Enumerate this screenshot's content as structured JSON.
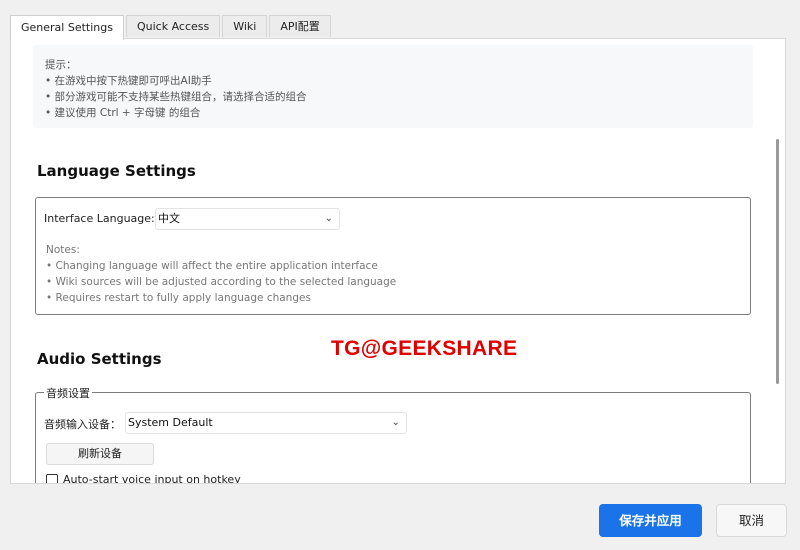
{
  "tabs": [
    {
      "label": "General Settings"
    },
    {
      "label": "Quick Access"
    },
    {
      "label": "Wiki"
    },
    {
      "label": "API配置"
    }
  ],
  "hotkey_hints": {
    "heading": "提示：",
    "lines": [
      "• 在游戏中按下热键即可呼出AI助手",
      "• 部分游戏可能不支持某些热键组合，请选择合适的组合",
      "• 建议使用 Ctrl + 字母键 的组合"
    ]
  },
  "language_settings": {
    "title": "Language Settings",
    "interface_language_label": "Interface Language:",
    "interface_language_value": "中文",
    "notes_heading": "Notes:",
    "notes": [
      "• Changing language will affect the entire application interface",
      "• Wiki sources will be adjusted according to the selected language",
      "• Requires restart to fully apply language changes"
    ]
  },
  "audio_settings": {
    "title": "Audio Settings",
    "group_title": "音频设置",
    "input_device_label": "音频输入设备：",
    "input_device_value": "System Default",
    "refresh_button": "刷新设备",
    "auto_start_label": "Auto-start voice input on hotkey",
    "auto_start_checked": false
  },
  "watermark": "TG@GEEKSHARE",
  "footer": {
    "save_button": "保存并应用",
    "cancel_button": "取消"
  },
  "colors": {
    "accent": "#1a73e8",
    "watermark": "#e00000"
  }
}
